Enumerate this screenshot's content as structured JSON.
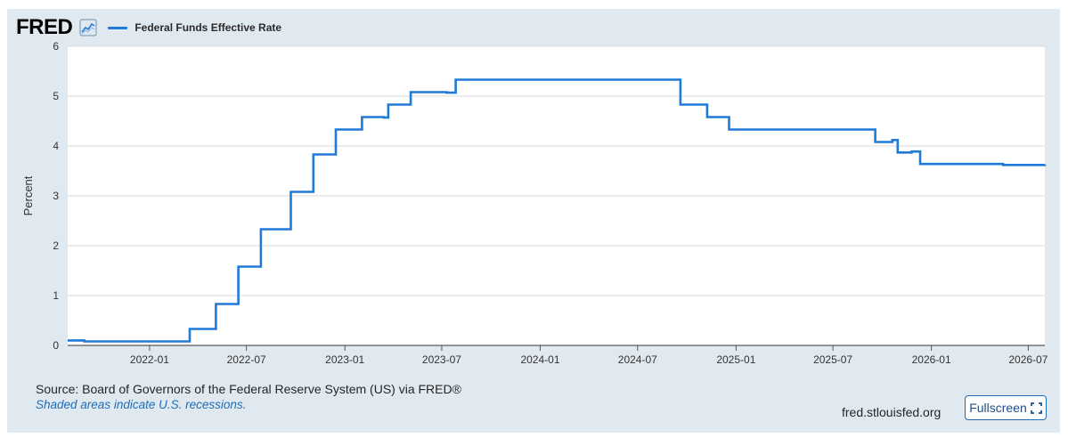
{
  "brand": {
    "logo_text": "FRED",
    "icon": "line-chart-icon"
  },
  "legend": {
    "label": "Federal Funds Effective Rate",
    "color": "#1f7ad8"
  },
  "footer": {
    "source": "Source: Board of Governors of the Federal Reserve System (US) via FRED®",
    "recession_note": "Shaded areas indicate U.S. recessions.",
    "url": "fred.stlouisfed.org",
    "fullscreen_label": "Fullscreen",
    "fullscreen_icon": "fullscreen-icon"
  },
  "colors": {
    "background": "#e1e9f0",
    "plot_bg": "#ffffff",
    "line": "#1f7ad8",
    "link": "#1f6db5"
  },
  "chart_data": {
    "type": "line",
    "title": "",
    "xlabel": "",
    "ylabel": "Percent",
    "ylim": [
      0,
      6
    ],
    "yticks": [
      "0",
      "1",
      "2",
      "3",
      "4",
      "5",
      "6"
    ],
    "xlim": [
      "2021-08-01",
      "2026-08-01"
    ],
    "xticks": [
      "2022-01",
      "2022-07",
      "2023-01",
      "2023-07",
      "2024-01",
      "2024-07",
      "2025-01",
      "2025-07",
      "2026-01",
      "2026-07"
    ],
    "grid": true,
    "legend": "top-left",
    "series": [
      {
        "name": "Federal Funds Effective Rate",
        "x": [
          "2021-08-01",
          "2021-09-01",
          "2022-03-17",
          "2022-05-05",
          "2022-06-16",
          "2022-07-28",
          "2022-09-22",
          "2022-11-03",
          "2022-12-15",
          "2023-02-02",
          "2023-03-15",
          "2023-03-23",
          "2023-05-04",
          "2023-07-10",
          "2023-07-27",
          "2024-09-19",
          "2024-11-08",
          "2024-12-19",
          "2025-09-18",
          "2025-10-20",
          "2025-10-30",
          "2025-11-25",
          "2025-12-11",
          "2026-05-15",
          "2026-08-01"
        ],
        "y": [
          0.1,
          0.08,
          0.33,
          0.83,
          1.58,
          2.33,
          3.08,
          3.83,
          4.33,
          4.58,
          4.57,
          4.83,
          5.08,
          5.07,
          5.33,
          4.83,
          4.58,
          4.33,
          4.08,
          4.12,
          3.87,
          3.89,
          3.64,
          3.62,
          3.63
        ]
      }
    ]
  }
}
